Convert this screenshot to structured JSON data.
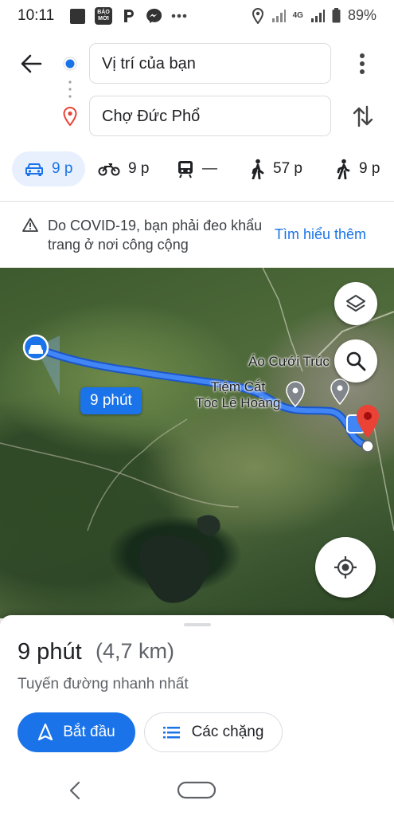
{
  "status_bar": {
    "time": "10:11",
    "baomoi": "BÁO MỚI",
    "network": "4G",
    "battery": "89%"
  },
  "route_inputs": {
    "origin": "Vị trí của bạn",
    "destination": "Chợ Đức Phổ"
  },
  "modes": [
    {
      "label": "9 p",
      "icon": "car-icon"
    },
    {
      "label": "9 p",
      "icon": "motorcycle-icon"
    },
    {
      "label": "—",
      "icon": "transit-icon"
    },
    {
      "label": "57 p",
      "icon": "walk-icon"
    },
    {
      "label": "9 p",
      "icon": "ride-hailing-icon"
    }
  ],
  "banner": {
    "text": "Do COVID-19, bạn phải đeo khẩu trang ở nơi công cộng",
    "link": "Tìm hiểu thêm"
  },
  "map": {
    "route_time": "9 phút",
    "places": [
      "Áo Cưới Trúc",
      "Tiệm Cắt\nTóc Lê Hoàng"
    ],
    "route_color": "#4285f4",
    "destination_color": "#ea4335"
  },
  "sheet": {
    "duration": "9 phút",
    "distance": "(4,7 km)",
    "subtitle": "Tuyến đường nhanh nhất",
    "start_label": "Bắt đầu",
    "steps_label": "Các chặng"
  },
  "colors": {
    "accent": "#1a73e8",
    "accent_bg": "#e8f0fe"
  }
}
